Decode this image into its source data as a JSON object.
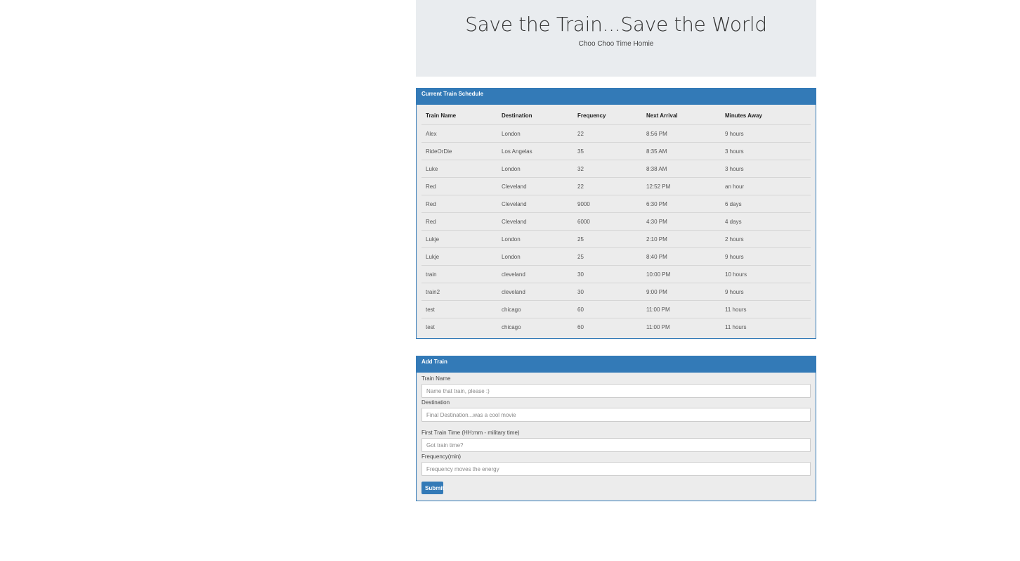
{
  "header": {
    "title": "Save the Train...Save the World",
    "subtitle": "Choo Choo Time Homie"
  },
  "schedule": {
    "heading": "Current Train Schedule",
    "columns": [
      "Train Name",
      "Destination",
      "Frequency",
      "Next Arrival",
      "Minutes Away"
    ],
    "rows": [
      [
        "Alex",
        "London",
        "22",
        "8:56 PM",
        "9 hours"
      ],
      [
        "RideOrDie",
        "Los Angelas",
        "35",
        "8:35 AM",
        "3 hours"
      ],
      [
        "Luke",
        "London",
        "32",
        "8:38 AM",
        "3 hours"
      ],
      [
        "Red",
        "Cleveland",
        "22",
        "12:52 PM",
        "an hour"
      ],
      [
        "Red",
        "Cleveland",
        "9000",
        "6:30 PM",
        "6 days"
      ],
      [
        "Red",
        "Cleveland",
        "6000",
        "4:30 PM",
        "4 days"
      ],
      [
        "Lukje",
        "London",
        "25",
        "2:10 PM",
        "2 hours"
      ],
      [
        "Lukje",
        "London",
        "25",
        "8:40 PM",
        "9 hours"
      ],
      [
        "train",
        "cleveland",
        "30",
        "10:00 PM",
        "10 hours"
      ],
      [
        "train2",
        "cleveland",
        "30",
        "9:00 PM",
        "9 hours"
      ],
      [
        "test",
        "chicago",
        "60",
        "11:00 PM",
        "11 hours"
      ],
      [
        "test",
        "chicago",
        "60",
        "11:00 PM",
        "11 hours"
      ]
    ]
  },
  "form": {
    "heading": "Add Train",
    "train_name_label": "Train Name",
    "train_name_placeholder": "Name that train, please :)",
    "destination_label": "Destination",
    "destination_placeholder": "Final Destination...was a cool movie",
    "first_time_label": "First Train Time (HH:mm - military time)",
    "first_time_placeholder": "Got train time?",
    "frequency_label": "Frequency(min)",
    "frequency_placeholder": "Frequency moves the energy",
    "submit_label": "Submit"
  },
  "colors": {
    "primary": "#337ab7",
    "jumbotron_bg": "#e9ecef",
    "panel_bg": "#ececec"
  }
}
